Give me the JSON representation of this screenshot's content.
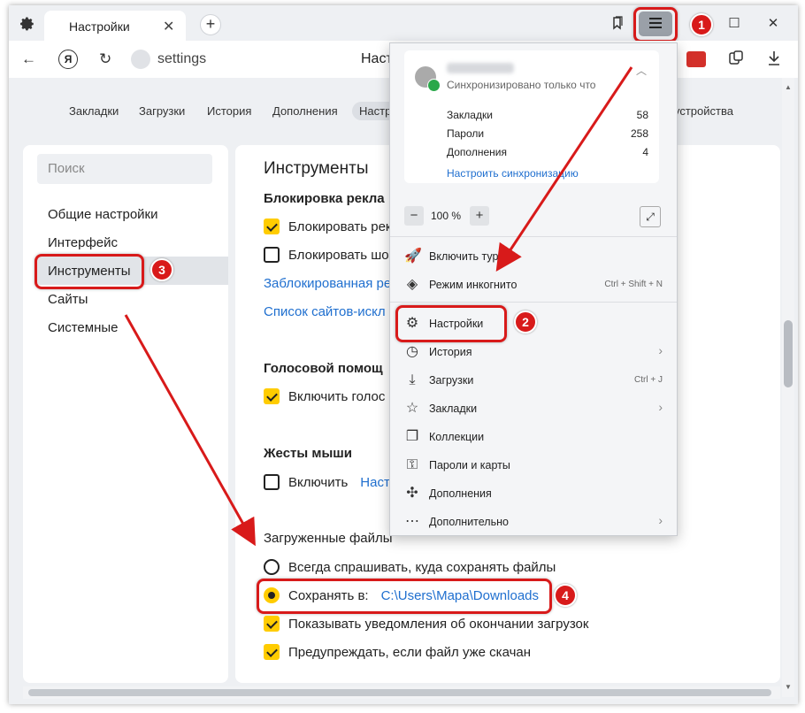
{
  "tab": {
    "title": "Настройки",
    "close": "✕",
    "new": "+"
  },
  "window": {
    "minimize": "—",
    "maximize": "☐",
    "close": "✕"
  },
  "address": {
    "url": "settings",
    "page_title": "Настройки",
    "yandex_letter": "Я"
  },
  "topnav": [
    "Закладки",
    "Загрузки",
    "История",
    "Дополнения",
    "Настр",
    "устройства"
  ],
  "sidebar": {
    "search_placeholder": "Поиск",
    "items": [
      "Общие настройки",
      "Интерфейс",
      "Инструменты",
      "Сайты",
      "Системные"
    ]
  },
  "main": {
    "heading": "Инструменты",
    "ads_title": "Блокировка рекла",
    "ads_row1": "Блокировать рек",
    "ads_row2": "Блокировать шо",
    "ads_link1": "Заблокированная ре",
    "ads_link2": "Список сайтов-искл",
    "voice_title": "Голосовой помощ",
    "voice_row": "Включить голос",
    "gestures_title": "Жесты мыши",
    "gestures_row": "Включить",
    "gestures_link": "Настр",
    "downloads_title": "Загруженные файлы",
    "dl_ask": "Всегда спрашивать, куда сохранять файлы",
    "dl_save_label": "Сохранять в:",
    "dl_path": "C:\\Users\\Mapa\\Downloads",
    "dl_notify": "Показывать уведомления об окончании загрузок",
    "dl_warn": "Предупреждать, если файл уже скачан"
  },
  "menu": {
    "sync_status": "Синхронизировано только что",
    "sync_rows": [
      {
        "label": "Закладки",
        "count": "58"
      },
      {
        "label": "Пароли",
        "count": "258"
      },
      {
        "label": "Дополнения",
        "count": "4"
      }
    ],
    "sync_link": "Настроить синхронизацию",
    "zoom": "100 %",
    "zoom_minus": "−",
    "zoom_plus": "+",
    "items": [
      {
        "label": "Включить турбо",
        "shortcut": "",
        "arrow": ""
      },
      {
        "label": "Режим инкогнито",
        "shortcut": "Ctrl + Shift + N",
        "arrow": ""
      },
      {
        "label": "Настройки",
        "shortcut": "",
        "arrow": ""
      },
      {
        "label": "История",
        "shortcut": "",
        "arrow": "›"
      },
      {
        "label": "Загрузки",
        "shortcut": "Ctrl + J",
        "arrow": ""
      },
      {
        "label": "Закладки",
        "shortcut": "",
        "arrow": "›"
      },
      {
        "label": "Коллекции",
        "shortcut": "",
        "arrow": ""
      },
      {
        "label": "Пароли и карты",
        "shortcut": "",
        "arrow": ""
      },
      {
        "label": "Дополнения",
        "shortcut": "",
        "arrow": ""
      },
      {
        "label": "Дополнительно",
        "shortcut": "",
        "arrow": "›"
      }
    ]
  },
  "annotations": {
    "b1": "1",
    "b2": "2",
    "b3": "3",
    "b4": "4"
  },
  "colors": {
    "highlight": "#d81a1a",
    "accent_yellow": "#ffcc00",
    "link": "#1f6fcf"
  }
}
